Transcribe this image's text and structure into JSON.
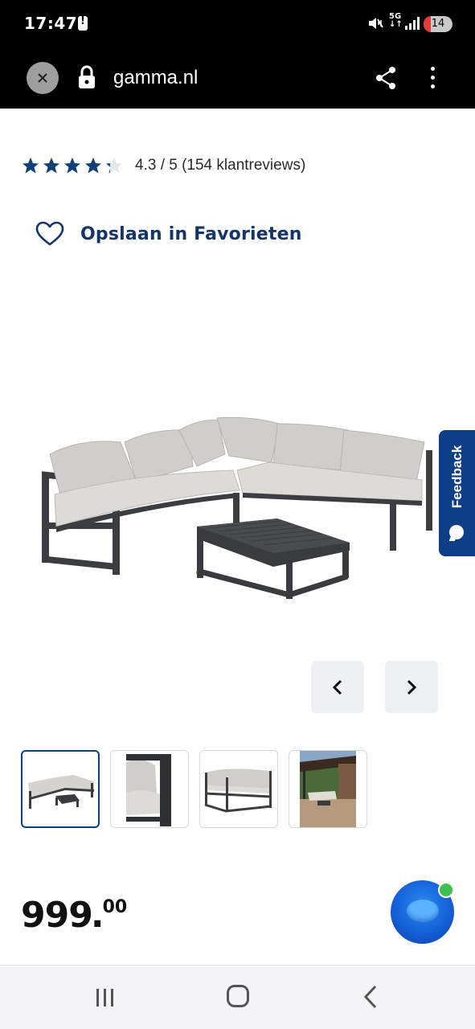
{
  "status_bar": {
    "time": "17:47",
    "network": "5G",
    "battery": "14"
  },
  "browser": {
    "url": "gamma.nl",
    "close_icon": "close-icon",
    "lock_icon": "lock-icon",
    "share_icon": "share-icon",
    "menu_icon": "more-vert-icon"
  },
  "product": {
    "rating": {
      "value": 4.3,
      "max": 5,
      "stars_filled": 4,
      "text": "4.3 / 5 (154 klantreviews)"
    },
    "favorite_label": "Opslaan in Favorieten",
    "feedback_label": "Feedback",
    "price": {
      "main": "999",
      "cents": "00"
    },
    "thumbnails": [
      {
        "name": "thumb-overview",
        "active": true
      },
      {
        "name": "thumb-detail-corner",
        "active": false
      },
      {
        "name": "thumb-sofa-side",
        "active": false
      },
      {
        "name": "thumb-lifestyle",
        "active": false
      }
    ]
  },
  "colors": {
    "brand_blue": "#153566",
    "star_blue": "#0f3f7a",
    "feedback_bg": "#0e3e88",
    "assistant_blue": "#1560d8",
    "online_green": "#3fbf4d"
  },
  "nav": {
    "recents_icon": "recents-icon",
    "home_icon": "home-icon",
    "back_icon": "back-icon"
  }
}
